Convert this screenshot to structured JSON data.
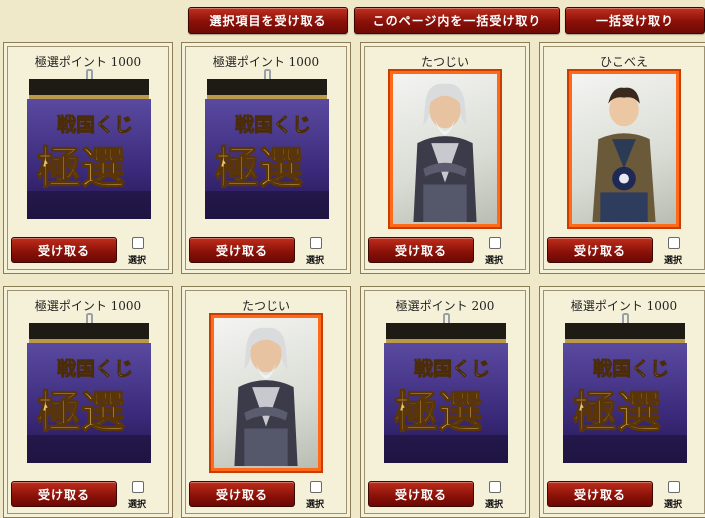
{
  "toolbar": {
    "receive_selected_label": "選択項目を受け取る",
    "receive_page_label": "このページ内を一括受け取り",
    "receive_all_label": "一括受け取り"
  },
  "bag_art": {
    "line1": "戦国くじ",
    "line2": "極選"
  },
  "cards": [
    {
      "title": "極選ポイント 1000",
      "kind": "bag",
      "receive_label": "受け取る",
      "select_label": "選択"
    },
    {
      "title": "極選ポイント 1000",
      "kind": "bag",
      "receive_label": "受け取る",
      "select_label": "選択"
    },
    {
      "title": "たつじい",
      "kind": "portrait-elder",
      "receive_label": "受け取る",
      "select_label": "選択"
    },
    {
      "title": "ひこべえ",
      "kind": "portrait-young",
      "receive_label": "受け取る",
      "select_label": "選択"
    },
    {
      "title": "極選ポイント 1000",
      "kind": "bag",
      "receive_label": "受け取る",
      "select_label": "選択"
    },
    {
      "title": "たつじい",
      "kind": "portrait-elder",
      "receive_label": "受け取る",
      "select_label": "選択"
    },
    {
      "title": "極選ポイント 200",
      "kind": "bag",
      "receive_label": "受け取る",
      "select_label": "選択"
    },
    {
      "title": "極選ポイント 1000",
      "kind": "bag",
      "receive_label": "受け取る",
      "select_label": "選択"
    }
  ],
  "colors": {
    "background": "#efe9c9",
    "button_red": "#8d1209",
    "frame_orange": "#ff6a1a",
    "bag_purple": "#3b2a7a",
    "gold": "#d8b45a"
  }
}
